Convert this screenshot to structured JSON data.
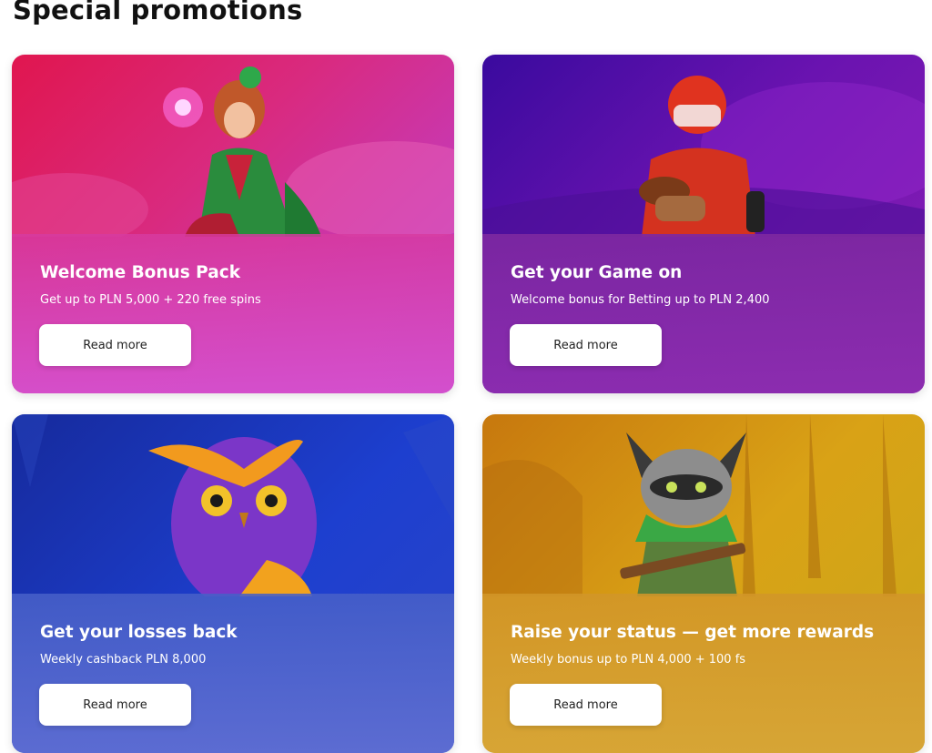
{
  "page": {
    "title": "Special promotions"
  },
  "promotions": [
    {
      "title": "Welcome Bonus Pack",
      "subtitle": "Get up to PLN 5,000 + 220 free spins",
      "button_label": "Read more",
      "image": "elf-girl-character",
      "accent": "#d92a7f"
    },
    {
      "title": "Get your Game on",
      "subtitle": "Welcome bonus for Betting up to PLN 2,400",
      "button_label": "Read more",
      "image": "american-football-player",
      "accent": "#6a13b0"
    },
    {
      "title": "Get your losses back",
      "subtitle": "Weekly cashback PLN 8,000",
      "button_label": "Read more",
      "image": "purple-owl-character",
      "accent": "#1d3fcf"
    },
    {
      "title": "Raise your status — get more rewards",
      "subtitle": "Weekly bonus up to PLN 4,000 + 100 fs",
      "button_label": "Read more",
      "image": "raccoon-crossbow-character",
      "accent": "#d9a216"
    }
  ]
}
